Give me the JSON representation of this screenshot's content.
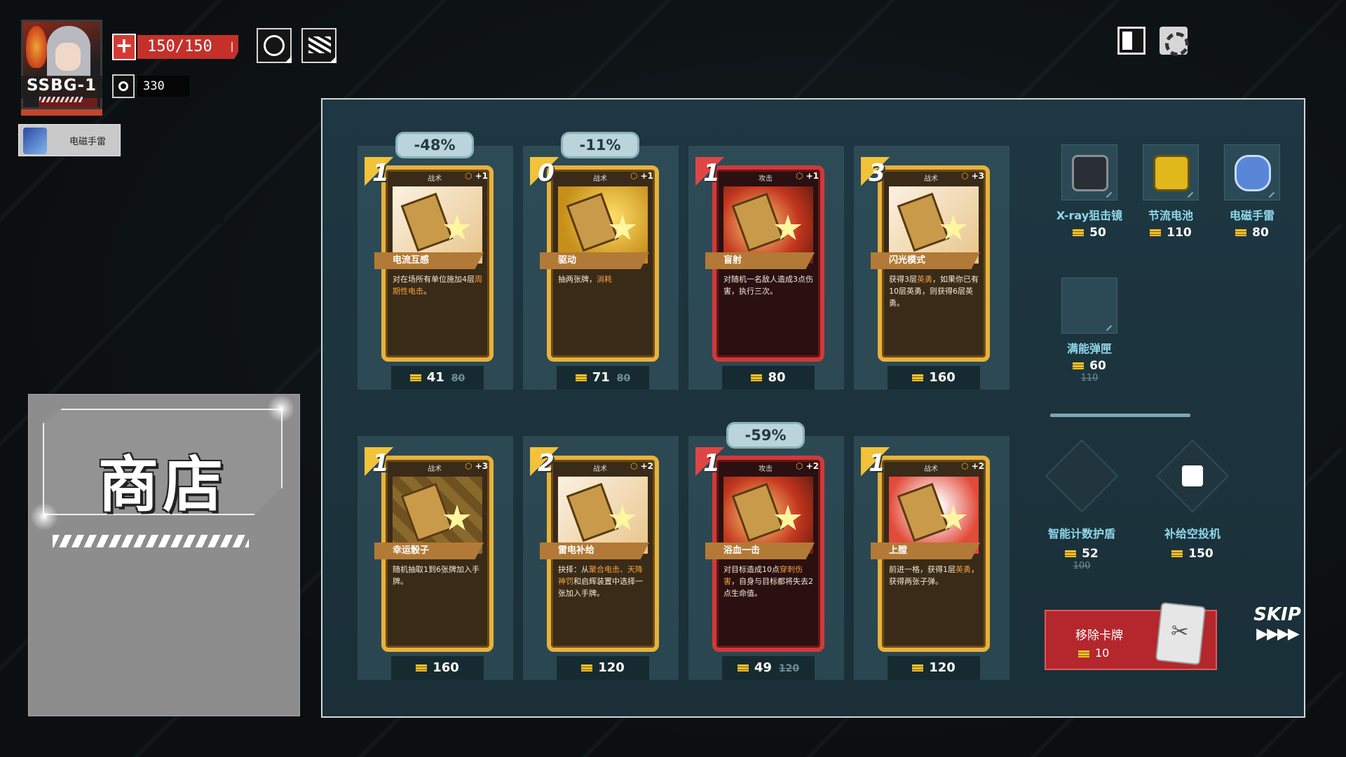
{
  "player": {
    "name": "SSBG-1",
    "hp": "150/150",
    "gold": "330"
  },
  "relic_slot": {
    "label": "电磁手雷",
    "icon": "grenade-icon"
  },
  "top_right": {
    "deck": "deck-icon",
    "settings": "gear-icon"
  },
  "shop_title": "商店",
  "cards": [
    {
      "cost": "1",
      "type": "战术",
      "upgrade": "+1",
      "name": "电流互感",
      "desc_prefix": "对在场所有单位施加4层",
      "desc_hl": "周期性电击",
      "desc_suffix": "。",
      "price": "41",
      "old_price": "80",
      "discount": "-48%",
      "style": "tactic"
    },
    {
      "cost": "0",
      "type": "战术",
      "upgrade": "+1",
      "name": "驱动",
      "desc_prefix": "抽两张牌，",
      "desc_hl": "消耗",
      "desc_suffix": "",
      "price": "71",
      "old_price": "80",
      "discount": "-11%",
      "style": "tactic"
    },
    {
      "cost": "1",
      "type": "攻击",
      "upgrade": "+1",
      "name": "盲射",
      "desc_prefix": "对随机一名敌人造成3点伤害，执行三次。",
      "desc_hl": "",
      "desc_suffix": "",
      "price": "80",
      "old_price": "",
      "discount": "",
      "style": "attack"
    },
    {
      "cost": "3",
      "type": "战术",
      "upgrade": "+3",
      "name": "闪光模式",
      "desc_prefix": "获得3层",
      "desc_hl": "英勇",
      "desc_suffix": "，如果你已有10层英勇，则获得6层英勇。",
      "price": "160",
      "old_price": "",
      "discount": "",
      "style": "tactic"
    },
    {
      "cost": "1",
      "type": "战术",
      "upgrade": "+3",
      "name": "幸运骰子",
      "desc_prefix": "随机抽取1到6张牌加入手牌。",
      "desc_hl": "",
      "desc_suffix": "",
      "price": "160",
      "old_price": "",
      "discount": "",
      "style": "tactic"
    },
    {
      "cost": "2",
      "type": "战术",
      "upgrade": "+2",
      "name": "雷电补给",
      "desc_prefix": "抉择：从",
      "desc_hl": "聚合电击、天降神罚",
      "desc_suffix": "和启辉装置中选择一张加入手牌。",
      "price": "120",
      "old_price": "",
      "discount": "",
      "style": "tactic"
    },
    {
      "cost": "1",
      "type": "攻击",
      "upgrade": "+2",
      "name": "浴血一击",
      "desc_prefix": "对目标造成10点",
      "desc_hl": "穿刺伤害",
      "desc_suffix": "，自身与目标都将失去2点生命值。",
      "price": "49",
      "old_price": "120",
      "discount": "-59%",
      "style": "attack"
    },
    {
      "cost": "1",
      "type": "战术",
      "upgrade": "+2",
      "name": "上膛",
      "desc_prefix": "前进一格，获得1层",
      "desc_hl": "英勇",
      "desc_suffix": "，获得两张子弹。",
      "price": "120",
      "old_price": "",
      "discount": "",
      "style": "tactic"
    }
  ],
  "relics": [
    {
      "name": "X-ray狙击镜",
      "price": "50",
      "old_price": "",
      "icon": "camera-scope-icon",
      "color": "#2a2f35"
    },
    {
      "name": "节流电池",
      "price": "110",
      "old_price": "",
      "icon": "battery-icon",
      "color": "#e0b81c"
    },
    {
      "name": "电磁手雷",
      "price": "80",
      "old_price": "",
      "icon": "grenade-icon",
      "color": "#5a86d8"
    },
    {
      "name": "满能弹匣",
      "price": "60",
      "old_price": "110",
      "icon": "magazine-icon",
      "color": ""
    }
  ],
  "utilities": [
    {
      "name": "智能计数护盾",
      "price": "52",
      "old_price": "100",
      "icon": "shield-icon"
    },
    {
      "name": "补给空投机",
      "price": "150",
      "old_price": "",
      "icon": "cards-icon"
    }
  ],
  "remove_card": {
    "label": "移除卡牌",
    "price": "10",
    "icon": "scissors-card-icon"
  },
  "skip": {
    "label": "SKIP",
    "arrows": "▶▶▶▶"
  },
  "colors": {
    "panel": "#1d3540",
    "hp": "#c5302a",
    "gold_coin": "#f4c12a",
    "relic_name": "#8fd8ea",
    "attack": "#cf3a3a",
    "tactic": "#e7b23b"
  }
}
